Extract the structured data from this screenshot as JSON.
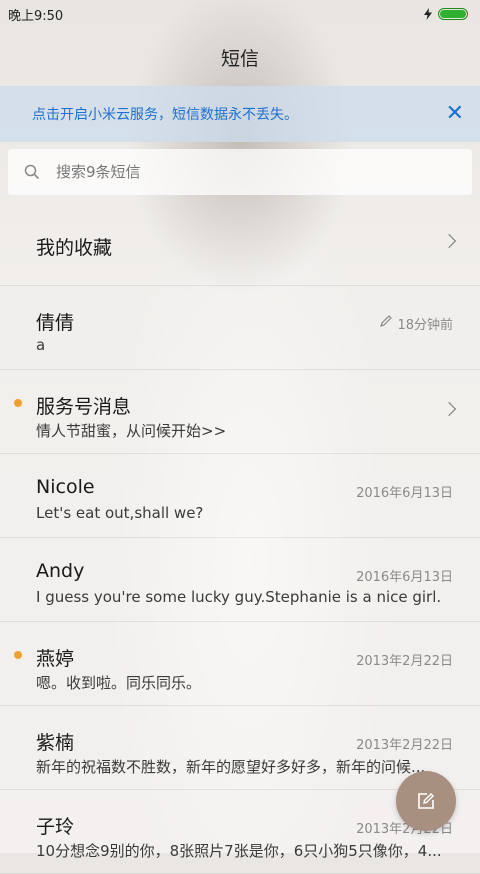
{
  "status_bar": {
    "time": "晚上9:50",
    "battery_level": 1.0,
    "battery_color": "#2fb12f"
  },
  "header": {
    "title": "短信"
  },
  "banner": {
    "text": "点击开启小米云服务，短信数据永不丢失。",
    "color": "#1f6fd0",
    "close_icon": "close-icon"
  },
  "search": {
    "placeholder": "搜索9条短信"
  },
  "favorites": {
    "label": "我的收藏"
  },
  "conversations": [
    {
      "name": "倩倩",
      "preview": "a",
      "time": "18分钟前",
      "draft": true,
      "unread": false
    },
    {
      "name": "服务号消息",
      "preview": "情人节甜蜜，从问候开始>>",
      "time": "",
      "unread": true,
      "chevron": true
    },
    {
      "name": "Nicole",
      "preview": "Let's eat out,shall we?",
      "time": "2016年6月13日",
      "unread": false
    },
    {
      "name": "Andy",
      "preview": "I guess you're some lucky guy.Stephanie is a nice girl.",
      "time": "2016年6月13日",
      "unread": false
    },
    {
      "name": "燕婷",
      "preview": "嗯。收到啦。同乐同乐。",
      "time": "2013年2月22日",
      "unread": true
    },
    {
      "name": "紫楠",
      "preview": "新年的祝福数不胜数，新年的愿望好多好多，新年的问候...",
      "time": "2013年2月22日",
      "unread": false
    },
    {
      "name": "子玲",
      "preview": "10分想念9别的你，8张照片7张是你，6只小狗5只像你，4...",
      "time": "2013年2月22日",
      "unread": false
    }
  ],
  "accent": {
    "unread_dot": "#f0a030",
    "fab": "#a89080"
  }
}
